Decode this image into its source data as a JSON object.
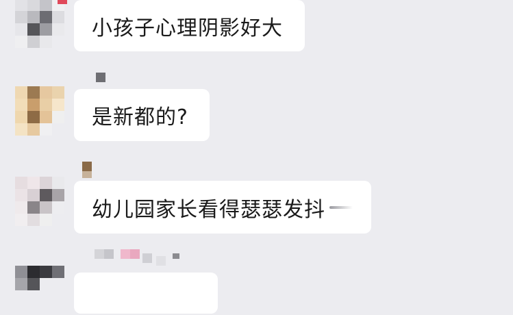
{
  "chat": {
    "messages": [
      {
        "text": "小孩子心理阴影好大"
      },
      {
        "text": "是新都的?"
      },
      {
        "text": "幼儿园家长看得瑟瑟发抖"
      },
      {
        "text": ""
      }
    ]
  },
  "colors": {
    "background": "#ececf0",
    "bubble": "#ffffff",
    "text": "#1a1a1a"
  }
}
